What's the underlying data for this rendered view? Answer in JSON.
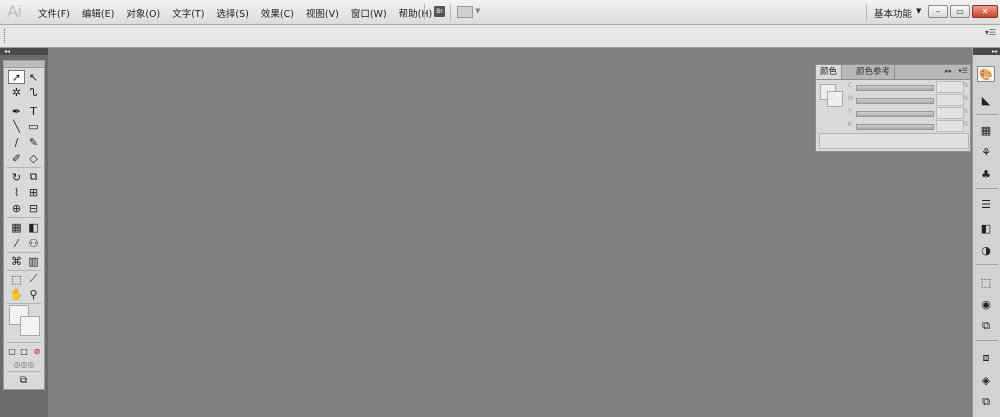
{
  "app": {
    "logo": "Ai"
  },
  "menu": [
    "文件(F)",
    "编辑(E)",
    "对象(O)",
    "文字(T)",
    "选择(S)",
    "效果(C)",
    "视图(V)",
    "窗口(W)",
    "帮助(H)"
  ],
  "bridge_label": "Br",
  "workspace": {
    "label": "基本功能",
    "caret": "▼"
  },
  "window_controls": {
    "minimize": "–",
    "restore": "▭",
    "close": "✕"
  },
  "color_panel": {
    "tabs": [
      "颜色",
      "颜色参考"
    ],
    "channels": [
      "C",
      "M",
      "Y",
      "K"
    ],
    "percent": "%"
  },
  "icons": {
    "tools": [
      "selection-tool-icon",
      "direct-selection-tool-icon",
      "magic-wand-tool-icon",
      "lasso-tool-icon",
      "pen-tool-icon",
      "type-tool-icon",
      "line-segment-tool-icon",
      "rectangle-tool-icon",
      "paintbrush-tool-icon",
      "pencil-tool-icon",
      "blob-brush-tool-icon",
      "eraser-tool-icon",
      "rotate-tool-icon",
      "scale-tool-icon",
      "warp-tool-icon",
      "free-transform-tool-icon",
      "shape-builder-tool-icon",
      "perspective-grid-tool-icon",
      "mesh-tool-icon",
      "gradient-tool-icon",
      "eyedropper-tool-icon",
      "blend-tool-icon",
      "symbol-sprayer-tool-icon",
      "column-graph-tool-icon",
      "artboard-tool-icon",
      "slice-tool-icon",
      "hand-tool-icon",
      "zoom-tool-icon"
    ],
    "dock": [
      "color-panel-icon",
      "color-guide-icon",
      "swatches-icon",
      "brushes-icon",
      "symbols-icon",
      "stroke-icon",
      "gradient-icon",
      "transparency-icon",
      "transform-icon",
      "appearance-icon",
      "graphic-styles-icon",
      "align-icon",
      "layers-icon",
      "artboards-icon"
    ]
  }
}
